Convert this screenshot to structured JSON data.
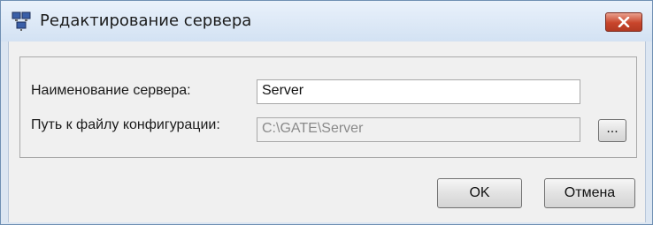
{
  "window": {
    "title": "Редактирование сервера"
  },
  "form": {
    "server_name_label": "Наименование сервера:",
    "server_name_value": "Server",
    "config_path_label": "Путь к файлу конфигурации:",
    "config_path_value": "C:\\GATE\\Server",
    "browse_label": "..."
  },
  "buttons": {
    "ok_label": "OK",
    "cancel_label": "Отмена"
  },
  "icons": [
    "network-computer-icon",
    "close-icon"
  ],
  "colors": {
    "title_bar": "#dce6f2",
    "close_button": "#c8452b",
    "dialog_bg": "#f0f0f0"
  }
}
